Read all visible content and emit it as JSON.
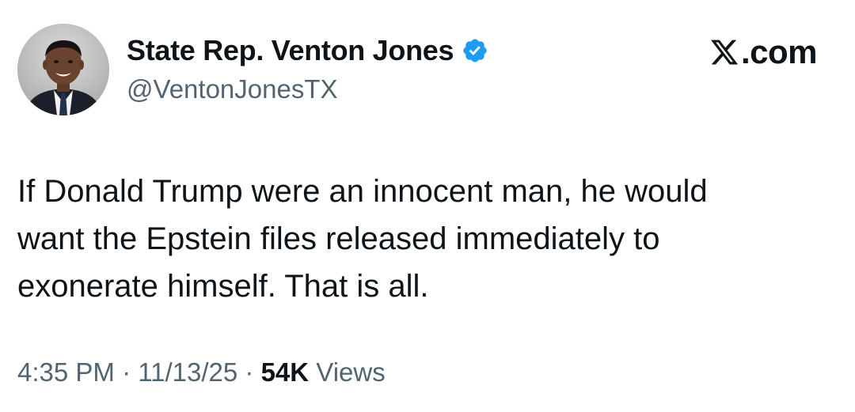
{
  "tweet": {
    "author": {
      "display_name": "State Rep. Venton Jones",
      "handle": "@VentonJonesTX",
      "verified": true,
      "verified_icon": "verified-badge-icon",
      "avatar_icon": "profile-avatar"
    },
    "brand": {
      "logo_icon": "x-logo-icon",
      "suffix": ".com"
    },
    "text_lines": [
      "If Donald Trump were an innocent man, he would",
      "want the Epstein files released immediately to",
      "exonerate himself. That is all."
    ],
    "meta": {
      "time": "4:35 PM",
      "separator": " · ",
      "date": "11/13/25",
      "views_count": "54K",
      "views_label": " Views"
    }
  },
  "colors": {
    "text_primary": "#0f1419",
    "text_secondary": "#536471",
    "verified_blue": "#1d9bf0"
  }
}
